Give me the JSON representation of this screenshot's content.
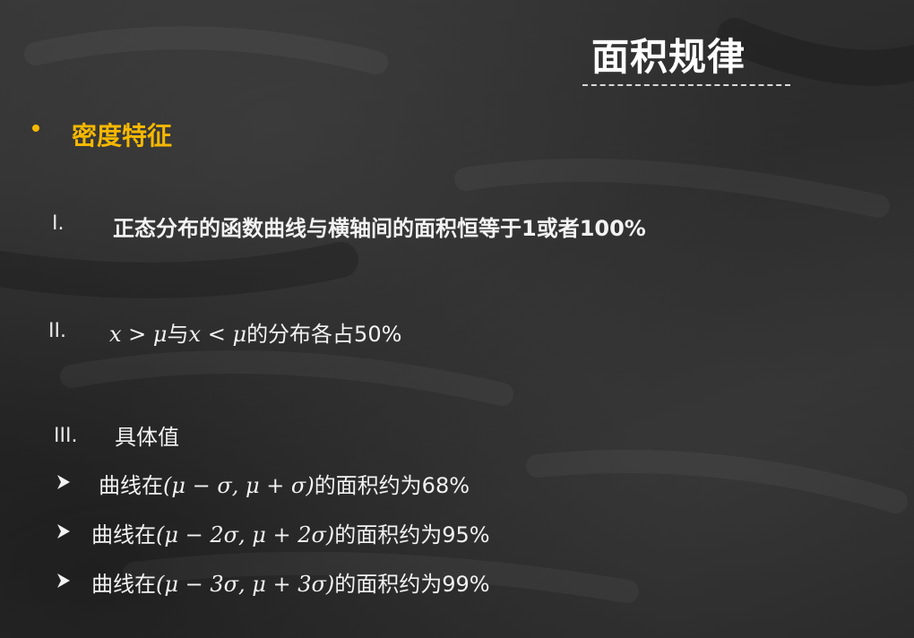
{
  "slide": {
    "title": "面积规律",
    "section_heading": "密度特征",
    "items": [
      {
        "numeral": "I.",
        "text": "正态分布的函数曲线与横轴间的面积恒等于1或者100%"
      },
      {
        "numeral": "II.",
        "math_x1": "x",
        "math_gt": " > ",
        "math_mu1": "μ",
        "text_with": "与",
        "math_x2": "x",
        "math_lt": " < ",
        "math_mu2": "μ",
        "text_rest": "的分布各占50%"
      },
      {
        "numeral": "III.",
        "text": "具体值"
      }
    ],
    "sub_items": [
      {
        "prefix": "曲线在",
        "interval": "(μ − σ, μ + σ)",
        "suffix": "的面积约为68%"
      },
      {
        "prefix": "曲线在",
        "interval": "(μ − 2σ, μ + 2σ)",
        "suffix": "的面积约为95%"
      },
      {
        "prefix": "曲线在",
        "interval": "(μ − 3σ, μ + 3σ)",
        "suffix": "的面积约为99%"
      }
    ],
    "colors": {
      "background": "#2e2e2e",
      "accent": "#f5b800",
      "text": "#f2f2f2"
    },
    "icons": {
      "bullet": "dot-bullet-icon",
      "sub_bullet": "arrow-bullet-icon"
    }
  }
}
